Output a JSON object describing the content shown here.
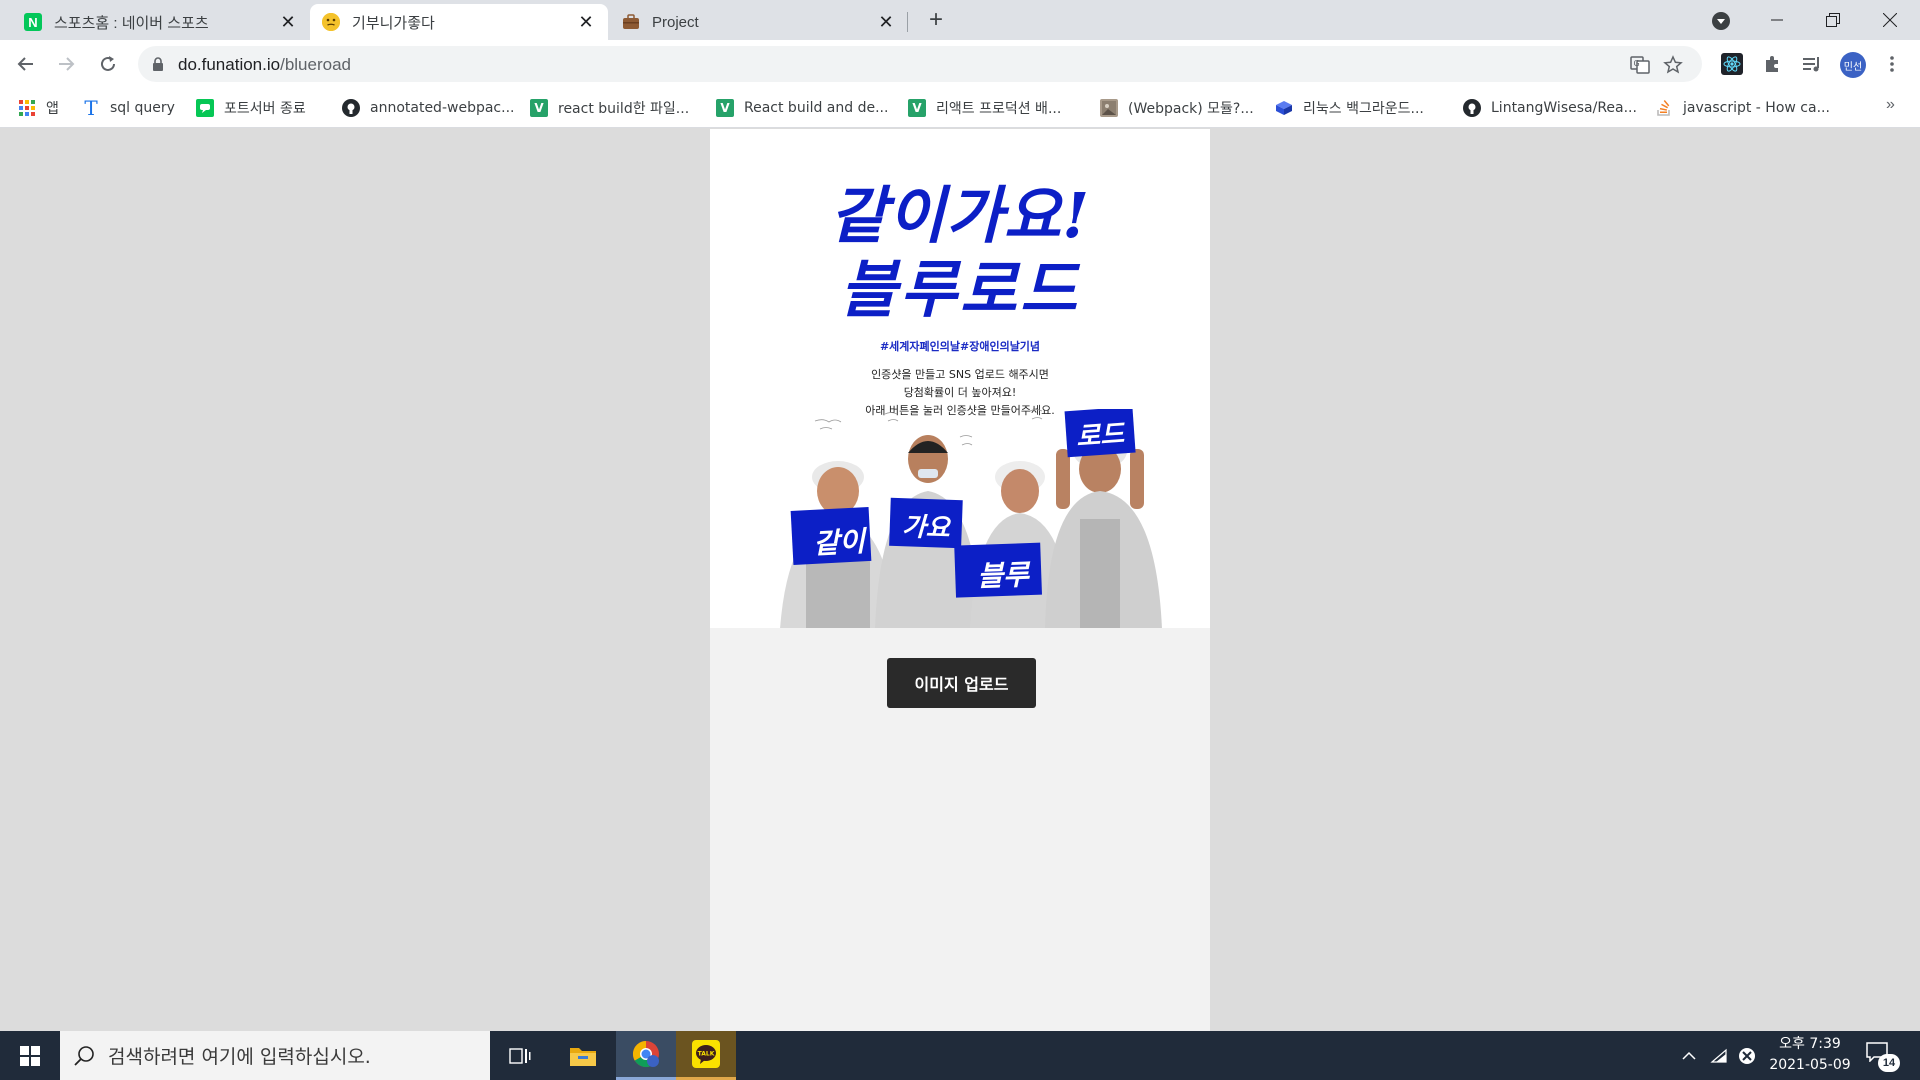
{
  "browser": {
    "tabs": [
      {
        "title": "스포츠홈 : 네이버 스포츠",
        "favicon": "N",
        "favicon_color": "#03c75a"
      },
      {
        "title": "기부니가좋다",
        "favicon": "emoji-face",
        "favicon_color": "#f4c22b"
      },
      {
        "title": "Project",
        "favicon": "briefcase-icon",
        "favicon_color": "#8d5a34"
      }
    ],
    "url_host": "do.funation.io",
    "url_path": "/blueroad",
    "profile_label": "민선"
  },
  "bookmarks": [
    {
      "label": "앱",
      "icon": "apps-grid-icon"
    },
    {
      "label": "sql query",
      "icon": "T",
      "color": "#1a73e8"
    },
    {
      "label": "포트서버 종료",
      "icon": "line-icon",
      "color": "#06c755"
    },
    {
      "label": "annotated-webpac...",
      "icon": "github-icon"
    },
    {
      "label": "react build한 파일...",
      "icon": "V",
      "color": "#26a269"
    },
    {
      "label": "React build and de...",
      "icon": "V",
      "color": "#26a269"
    },
    {
      "label": "리액트 프로덕션 배...",
      "icon": "V",
      "color": "#26a269"
    },
    {
      "label": "(Webpack) 모듈?...",
      "icon": "image-icon"
    },
    {
      "label": "리눅스 백그라운드...",
      "icon": "box-icon",
      "color": "#2b4fd6"
    },
    {
      "label": "LintangWisesa/Rea...",
      "icon": "github-icon"
    },
    {
      "label": "javascript - How ca...",
      "icon": "stackoverflow-icon",
      "color": "#f48024"
    }
  ],
  "bookmarks_more": "»",
  "poster": {
    "headline_line1": "같이가요!",
    "headline_line2": "블루로드",
    "hashtag": "#세계자폐인의날#장애인의날기념",
    "desc_line1": "인증샷을 만들고 SNS 업로드 해주시면",
    "desc_line2": "당첨확률이 더 높아져요!",
    "desc_line3": "아래 버튼을 눌러 인증샷을 만들어주세요.",
    "signs": [
      "같이",
      "가요",
      "블루",
      "로드"
    ],
    "accent_color": "#0c1fc6"
  },
  "upload_button_label": "이미지 업로드",
  "taskbar": {
    "search_placeholder": "검색하려면 여기에 입력하십시오.",
    "time": "오후 7:39",
    "date": "2021-05-09",
    "notifications": "14"
  }
}
